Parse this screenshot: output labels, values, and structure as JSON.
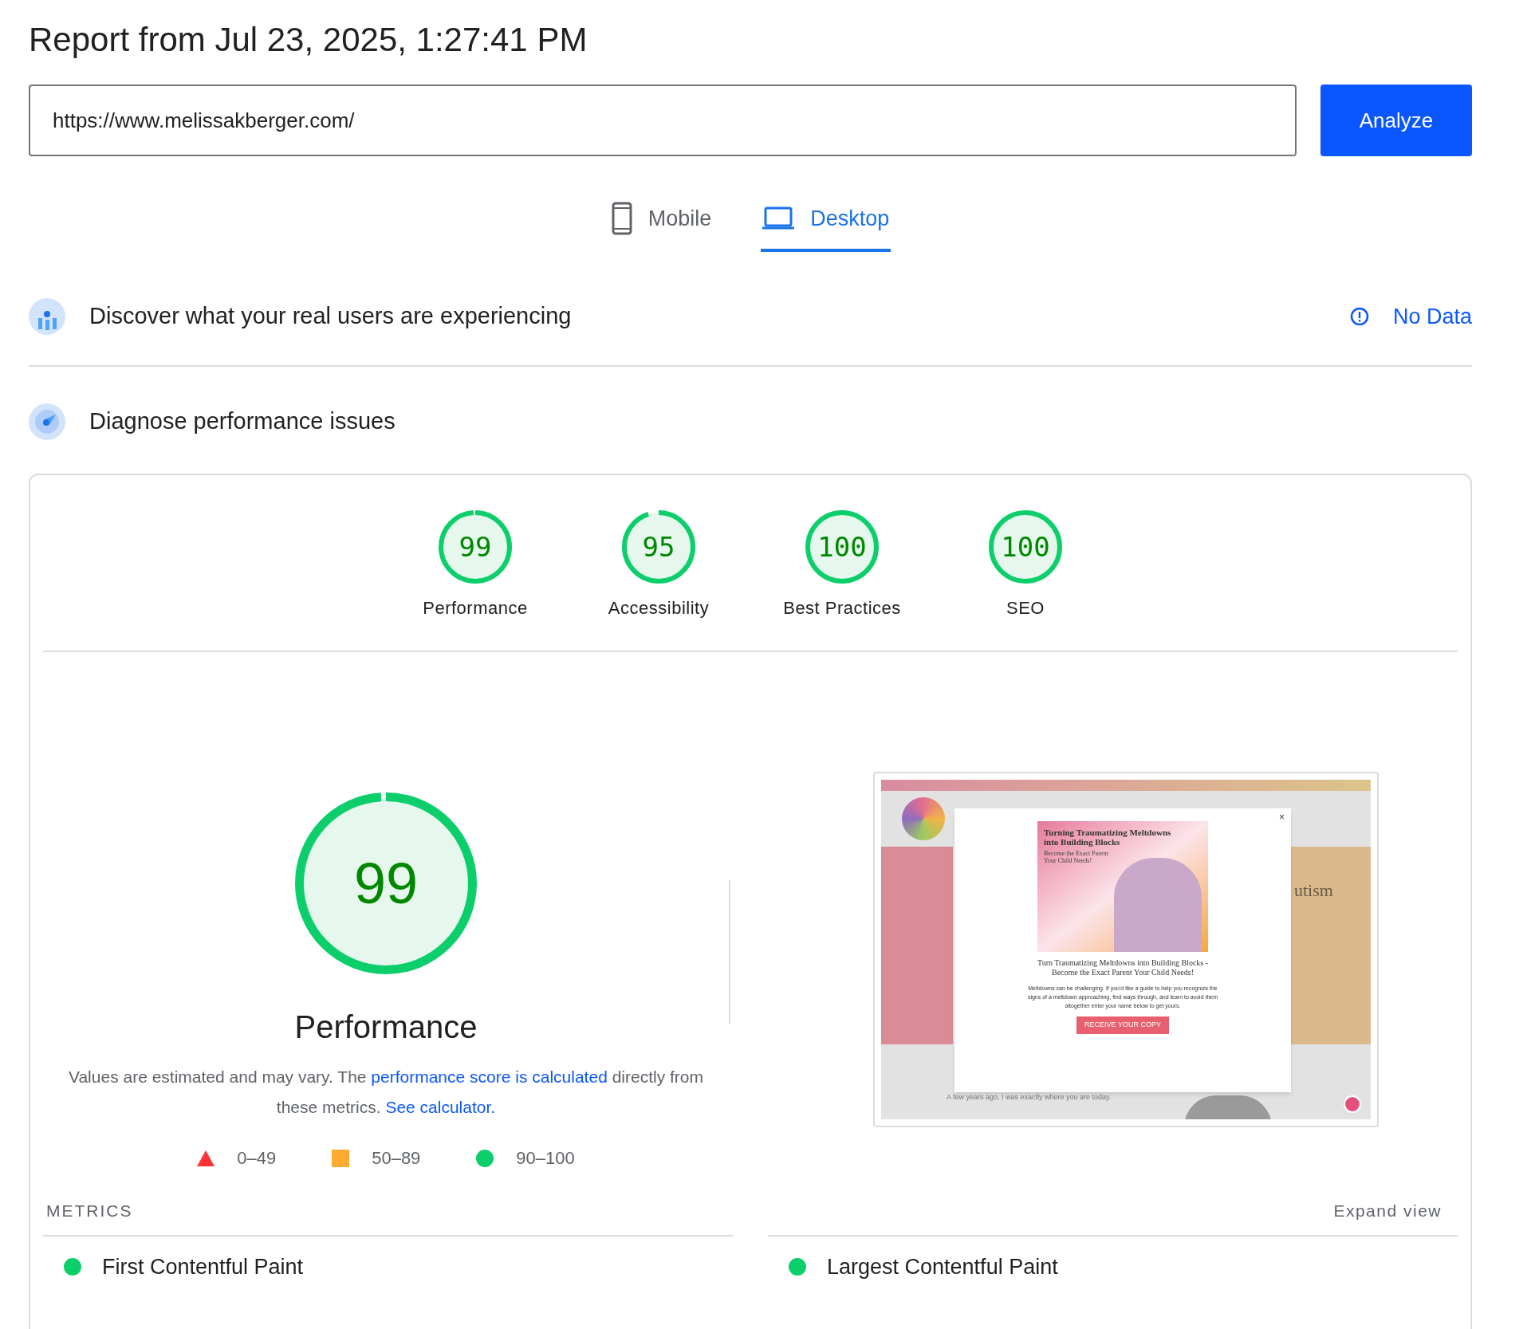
{
  "title": "Report from Jul 23, 2025, 1:27:41 PM",
  "url_field": {
    "value": "https://www.melissakberger.com/"
  },
  "analyze_button": "Analyze",
  "tabs": [
    {
      "label": "Mobile",
      "kind": "phone",
      "selected": false
    },
    {
      "label": "Desktop",
      "kind": "laptop",
      "selected": true
    }
  ],
  "field_data": {
    "title": "Discover what your real users are experiencing",
    "status": "No Data"
  },
  "lab_data": {
    "title": "Diagnose performance issues"
  },
  "scores": [
    {
      "value": "99",
      "label": "Performance",
      "level": 0.99
    },
    {
      "value": "95",
      "label": "Accessibility",
      "level": 0.95
    },
    {
      "value": "100",
      "label": "Best Practices",
      "level": 1
    },
    {
      "value": "100",
      "label": "SEO",
      "level": 1
    }
  ],
  "main_score": {
    "value": "99",
    "label": "Performance",
    "level": 0.99
  },
  "description": [
    {
      "text": "Values are estimated and may vary. The ",
      "link": false
    },
    {
      "text": "performance score is calculated",
      "link": true
    },
    {
      "text": " directly from these metrics. ",
      "link": false
    },
    {
      "text": "See calculator.",
      "link": true
    }
  ],
  "legend": [
    {
      "kind": "triangle",
      "label": "0–49",
      "color": "#ff3333"
    },
    {
      "kind": "square",
      "label": "50–89",
      "color": "#ffaa33"
    },
    {
      "kind": "circle",
      "label": "90–100",
      "color": "#0cce6b"
    }
  ],
  "preview": {
    "banner_title": "Turning Traumatizing Meltdowns into Building Blocks",
    "banner_subtitle": "Become the Exact Parent Your Child Needs!",
    "close": "×",
    "modal_heading": "Turn Traumatizing Meltdowns into Building Blocks - Become the Exact Parent Your Child Needs!",
    "modal_text": "Meltdowns can be challenging. If you'd like a guide to help you recognize the signs of a meltdown approaching, find ways through, and learn to avoid them altogether enter your name below to get yours.",
    "modal_button": "RECEIVE YOUR COPY",
    "side_heading": "utism",
    "intro": "A few years ago, I was exactly where you are today."
  },
  "metrics": {
    "heading": "METRICS",
    "expand": "Expand view",
    "items": [
      {
        "label": "First Contentful Paint",
        "color": "#0cce6b"
      },
      {
        "label": "Largest Contentful Paint",
        "color": "#0cce6b"
      }
    ]
  }
}
